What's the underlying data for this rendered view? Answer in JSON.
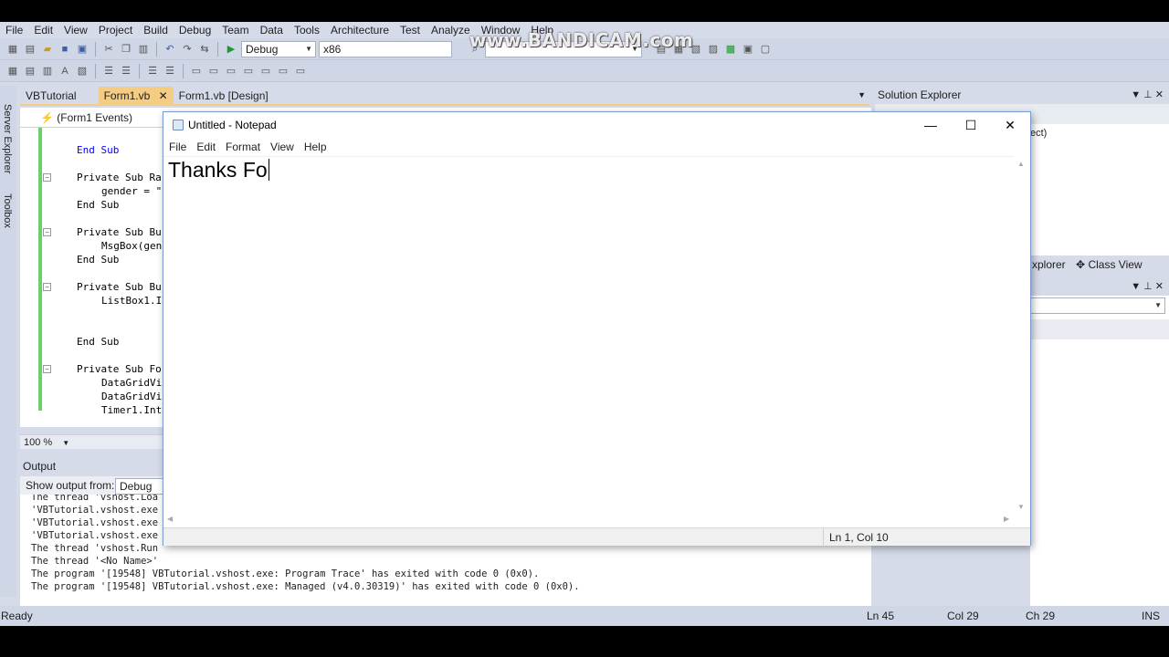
{
  "watermark": "www.BANDICAM.com",
  "vs": {
    "menu": [
      "File",
      "Edit",
      "View",
      "Project",
      "Build",
      "Debug",
      "Team",
      "Data",
      "Tools",
      "Architecture",
      "Test",
      "Analyze",
      "Window",
      "Help"
    ],
    "toolbar": {
      "config": "Debug",
      "platform": "x86"
    },
    "side_tabs": [
      "Server Explorer",
      "Toolbox"
    ],
    "doc_tabs": [
      "VBTutorial",
      "Form1.vb",
      "Form1.vb [Design]"
    ],
    "nav_events": "(Form1 Events)",
    "code_lines": [
      "End Sub",
      "Private Sub Ra",
      "gender = \"",
      "End Sub",
      "Private Sub Bu",
      "MsgBox(gen",
      "End Sub",
      "Private Sub Bu",
      "ListBox1.I",
      "End Sub",
      "Private Sub Fo",
      "DataGridVi",
      "DataGridVi",
      "Timer1.Int"
    ],
    "zoom": "100 %",
    "output": {
      "title": "Output",
      "show_label": "Show output from:",
      "source": "Debug",
      "lines": [
        "The thread 'vshost.Loa",
        "'VBTutorial.vshost.exe",
        "'VBTutorial.vshost.exe",
        "'VBTutorial.vshost.exe",
        "The thread 'vshost.Run",
        "The thread '<No Name>'",
        "The program '[19548] VBTutorial.vshost.exe: Program Trace' has exited with code 0 (0x0).",
        "The program '[19548] VBTutorial.vshost.exe: Managed (v4.0.30319)' has exited with code 0 (0x0)."
      ]
    },
    "solution_explorer": {
      "title": "Solution Explorer",
      "fragment": "ect)"
    },
    "pane_tabs": {
      "explorer": "xplorer",
      "class_view": "Class View"
    },
    "status": {
      "ready": "Ready",
      "ln": "Ln 45",
      "col": "Col 29",
      "ch": "Ch 29",
      "ins": "INS"
    }
  },
  "notepad": {
    "title": "Untitled - Notepad",
    "menu": [
      "File",
      "Edit",
      "Format",
      "View",
      "Help"
    ],
    "text": "Thanks Fo",
    "status": "Ln 1, Col 10"
  }
}
